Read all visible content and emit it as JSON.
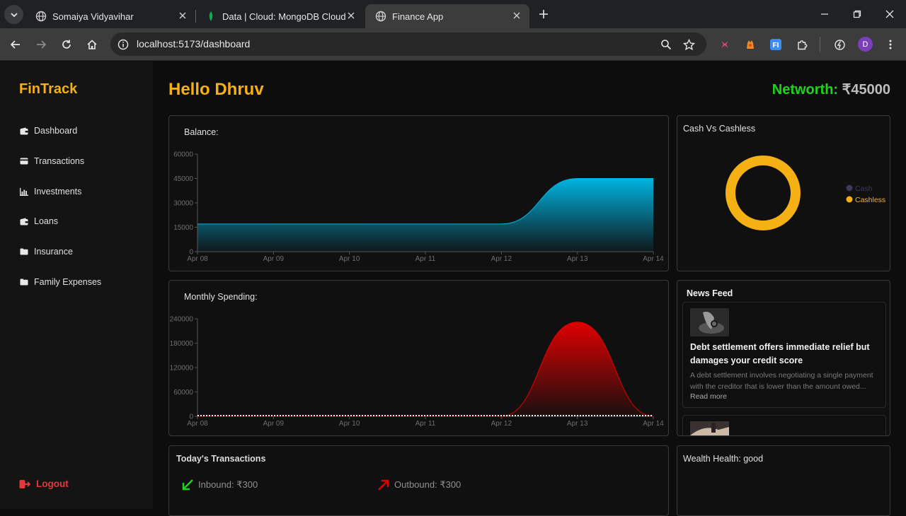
{
  "browser": {
    "tabs": [
      {
        "title": "Somaiya Vidyavihar"
      },
      {
        "title": "Data | Cloud: MongoDB Cloud"
      },
      {
        "title": "Finance App"
      }
    ],
    "url": "localhost:5173/dashboard",
    "profile_initial": "D"
  },
  "app": {
    "brand": "FinTrack",
    "nav": [
      {
        "label": "Dashboard",
        "icon": "wallet-icon"
      },
      {
        "label": "Transactions",
        "icon": "card-icon"
      },
      {
        "label": "Investments",
        "icon": "bar-chart-icon"
      },
      {
        "label": "Loans",
        "icon": "wallet-icon"
      },
      {
        "label": "Insurance",
        "icon": "folder-icon"
      },
      {
        "label": "Family Expenses",
        "icon": "folder-icon"
      }
    ],
    "logout_label": "Logout",
    "greeting": "Hello Dhruv",
    "networth_label": "Networth:",
    "networth_value": "₹45000",
    "balance": {
      "title": "Balance:"
    },
    "spending": {
      "title": "Monthly Spending:"
    },
    "cash": {
      "title": "Cash Vs Cashless"
    },
    "news": {
      "title": "News Feed",
      "items": [
        {
          "headline": "Debt settlement offers immediate relief but damages your credit score",
          "summary": "A debt settlement involves negotiating a single payment with the creditor that is lower than the amount owed...",
          "read_more": "Read more"
        }
      ]
    },
    "today": {
      "title": "Today's Transactions",
      "inbound": "Inbound: ₹300",
      "outbound": "Outbound: ₹300"
    },
    "wealth": {
      "title": "Wealth Health: good"
    },
    "colors": {
      "accent": "#f5b014",
      "networth": "#1cd41c",
      "balance_fill": "#00b4e0",
      "spending_fill": "#e00000",
      "cashless": "#f5b014",
      "cash": "#3a3a5a"
    }
  },
  "chart_data": [
    {
      "type": "area",
      "title": "Balance:",
      "x": [
        "Apr 08",
        "Apr 09",
        "Apr 10",
        "Apr 11",
        "Apr 12",
        "Apr 13",
        "Apr 14"
      ],
      "series": [
        {
          "values": [
            17000,
            17000,
            17000,
            17000,
            17000,
            45000,
            45000
          ]
        }
      ],
      "yticks": [
        "0",
        "15000",
        "30000",
        "45000",
        "60000"
      ],
      "ylim": [
        0,
        60000
      ]
    },
    {
      "type": "area",
      "title": "Monthly Spending:",
      "x": [
        "Apr 08",
        "Apr 09",
        "Apr 10",
        "Apr 11",
        "Apr 12",
        "Apr 13",
        "Apr 14"
      ],
      "series": [
        {
          "values": [
            0,
            0,
            0,
            0,
            0,
            232000,
            0
          ]
        }
      ],
      "yticks": [
        "0",
        "60000",
        "120000",
        "180000",
        "240000"
      ],
      "ylim": [
        0,
        240000
      ]
    },
    {
      "type": "pie",
      "title": "Cash Vs Cashless",
      "categories": [
        "Cash",
        "Cashless"
      ],
      "values": [
        0,
        100
      ]
    }
  ]
}
